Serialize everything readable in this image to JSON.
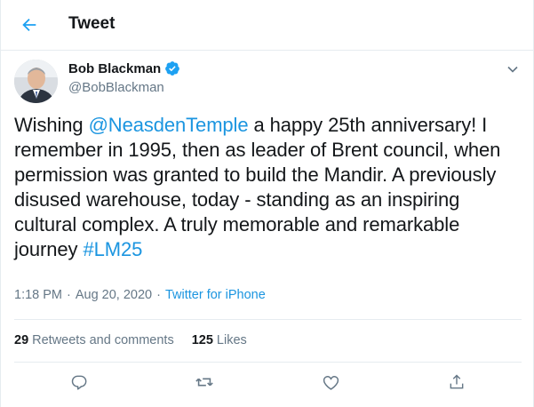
{
  "header": {
    "title": "Tweet",
    "back_icon": "back-arrow-icon"
  },
  "author": {
    "name": "Bob Blackman",
    "handle": "@BobBlackman",
    "verified": true,
    "avatar_icon": "avatar"
  },
  "tweet": {
    "text_before": "Wishing ",
    "mention": "@NeasdenTemple",
    "text_middle": " a happy 25th anniversary! I remember in 1995, then as leader of Brent council, when permission was granted to build the Mandir. A previously disused warehouse, today - standing as an inspiring cultural complex. A truly memorable and remarkable journey ",
    "hashtag": "#LM25"
  },
  "meta": {
    "time": "1:18 PM",
    "separator": "·",
    "date": "Aug 20, 2020",
    "source": "Twitter for iPhone"
  },
  "stats": {
    "retweets_count": "29",
    "retweets_label": "Retweets and comments",
    "likes_count": "125",
    "likes_label": "Likes"
  },
  "colors": {
    "accent": "#1b95e0",
    "verified": "#1da1f2",
    "text": "#14171a",
    "muted": "#657786",
    "border": "#e6ecf0"
  },
  "actions": [
    "reply-icon",
    "retweet-icon",
    "like-icon",
    "share-icon"
  ]
}
